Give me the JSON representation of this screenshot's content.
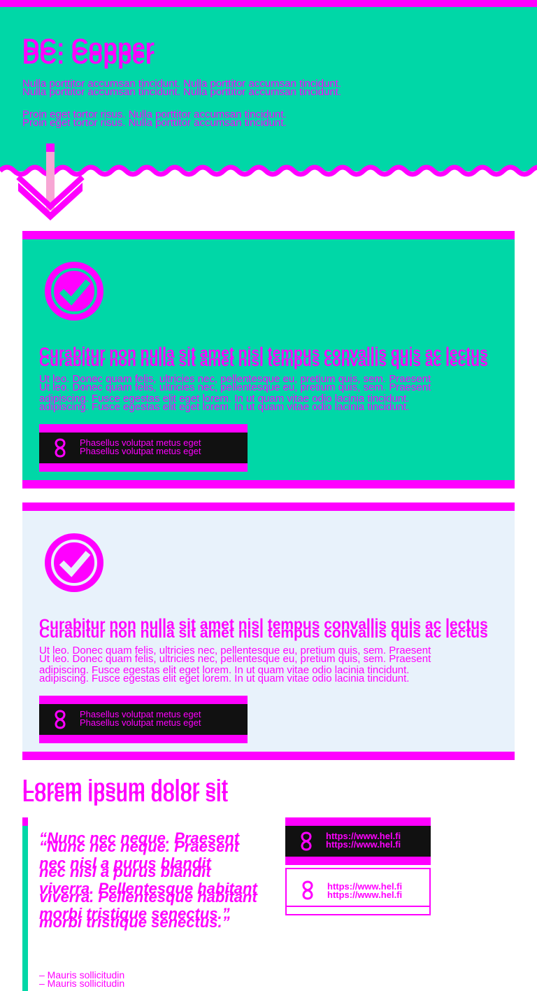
{
  "hero": {
    "title": "DC: Copper",
    "paragraph_1": "Nulla porttitor accumsan tincidunt. Nulla porttitor accumsan tincidunt.",
    "paragraph_2": "Proin eget tortor risus. Nulla porttitor accumsan tincidunt."
  },
  "cards": [
    {
      "title": "Curabitur non nulla sit amet nisl tempus convallis quis ac lectus",
      "body_line_1": "Ut leo. Donec quam felis, ultricies nec, pellentesque eu, pretium quis, sem. Praesent",
      "body_line_2": "adipiscing. Fusce egestas elit eget lorem. In ut quam vitae odio lacinia tincidunt.",
      "button_label": "Phasellus volutpat metus eget"
    },
    {
      "title": "Curabitur non nulla sit amet nisl tempus convallis quis ac lectus",
      "body_line_1": "Ut leo. Donec quam felis, ultricies nec, pellentesque eu, pretium quis, sem. Praesent",
      "body_line_2": "adipiscing. Fusce egestas elit eget lorem. In ut quam vitae odio lacinia tincidunt.",
      "button_label": "Phasellus volutpat metus eget"
    }
  ],
  "section": {
    "title": "Lorem ipsum dolor sit",
    "quote": "“Nunc nec neque. Praesent nec nisl a purus blandit viverra. Pellentesque habitant morbi tristique senectus.”",
    "author": "– Mauris sollicitudin",
    "links": [
      {
        "label": "https://www.hel.fi"
      },
      {
        "label": "https://www.hel.fi"
      }
    ]
  },
  "colors": {
    "accent": "#ff00ff",
    "teal": "#00d7a7",
    "light_panel": "#e8f2fb",
    "dark": "#111111"
  },
  "icons": [
    "arrow-down-icon",
    "checkmark-circle-icon",
    "link-glyph-icon"
  ]
}
